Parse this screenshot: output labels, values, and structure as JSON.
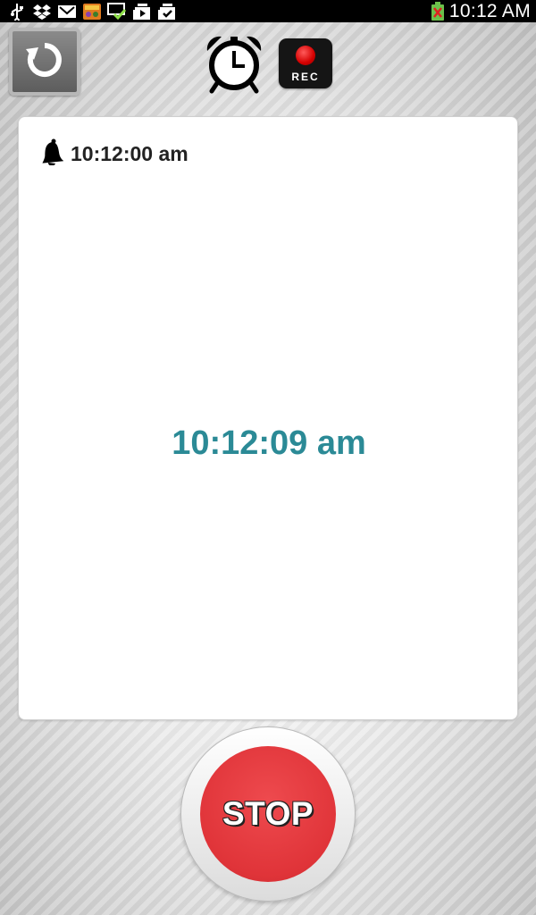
{
  "status_bar": {
    "time": "10:12 AM",
    "icons": [
      "usb-icon",
      "dropbox-icon",
      "gmail-icon",
      "game-app-icon",
      "download-done-icon",
      "media-upload-icon",
      "task-done-icon",
      "battery-icon"
    ]
  },
  "toolbar": {
    "reset_icon": "reset-icon",
    "alarm_icon": "alarm-clock-icon",
    "rec_label": "REC"
  },
  "card": {
    "alarm_icon": "bell-icon",
    "alarm_time": "10:12:00 am",
    "current_time": "10:12:09 am"
  },
  "stop_button": {
    "label": "STOP"
  },
  "colors": {
    "accent_time": "#2b8a96",
    "stop_red": "#e03439",
    "rec_red": "#d40000",
    "battery_green": "#6cc04a"
  }
}
